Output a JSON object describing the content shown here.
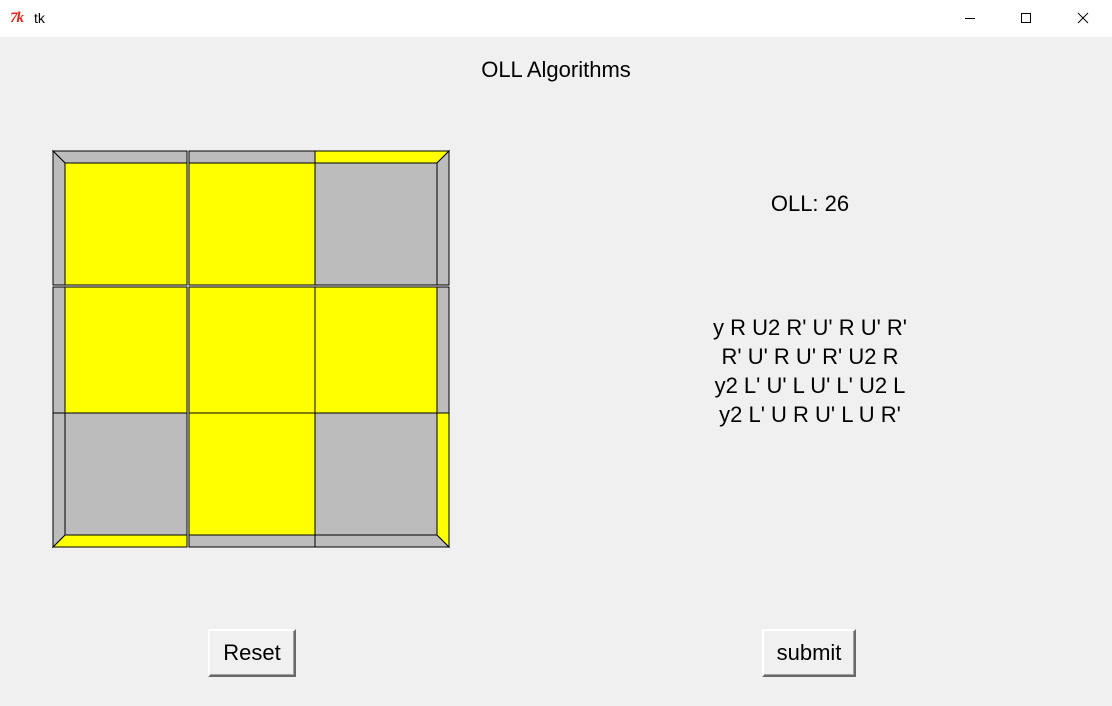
{
  "window": {
    "title": "tk",
    "icon": "tk-feather-icon",
    "icon_text": "7k",
    "controls": [
      "minimize-icon",
      "maximize-icon",
      "close-icon"
    ]
  },
  "header": {
    "title": "OLL Algorithms"
  },
  "colors": {
    "yellow": "#ffff00",
    "gray": "#bcbcbc",
    "outline": "#000000",
    "background": "#f0f0f0"
  },
  "cube": {
    "top_face": [
      [
        "yellow",
        "yellow",
        "gray"
      ],
      [
        "yellow",
        "yellow",
        "yellow"
      ],
      [
        "gray",
        "yellow",
        "gray"
      ]
    ],
    "sides": {
      "top": [
        "gray",
        "gray",
        "yellow"
      ],
      "bottom": [
        "yellow",
        "gray",
        "gray"
      ],
      "left": [
        "gray",
        "gray",
        "gray"
      ],
      "right": [
        "gray",
        "gray",
        "yellow"
      ]
    }
  },
  "case": {
    "label": "OLL:",
    "number": "26"
  },
  "algorithms": [
    "y R U2 R' U' R U' R'",
    "R' U' R U' R' U2 R",
    "y2 L' U' L U' L' U2 L",
    "y2 L' U R U' L U R'"
  ],
  "buttons": {
    "reset": "Reset",
    "submit": "submit"
  }
}
